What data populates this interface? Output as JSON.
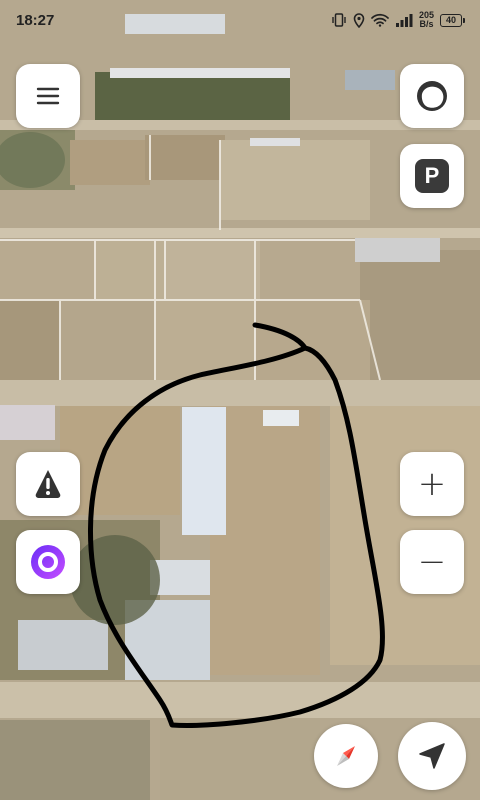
{
  "status_bar": {
    "time": "18:27",
    "net_speed_value": "205",
    "net_speed_unit": "B/s",
    "battery_level": "40"
  },
  "buttons": {
    "zoom_in_symbol": "+",
    "zoom_out_symbol": "−",
    "parking_label": "P"
  },
  "icons": {
    "menu": "hamburger-menu-icon",
    "layers": "map-layers-icon",
    "parking": "parking-icon",
    "alert": "road-alert-icon",
    "assistant": "voice-assistant-icon",
    "compass": "compass-icon",
    "navigate": "navigation-arrow-icon"
  },
  "colors": {
    "button_bg": "#ffffff",
    "icon_dark": "#333333",
    "assistant_gradient_start": "#8a3ffc",
    "assistant_gradient_end": "#c455ff",
    "compass_red": "#e5362a",
    "drawn_outline": "#000000"
  }
}
